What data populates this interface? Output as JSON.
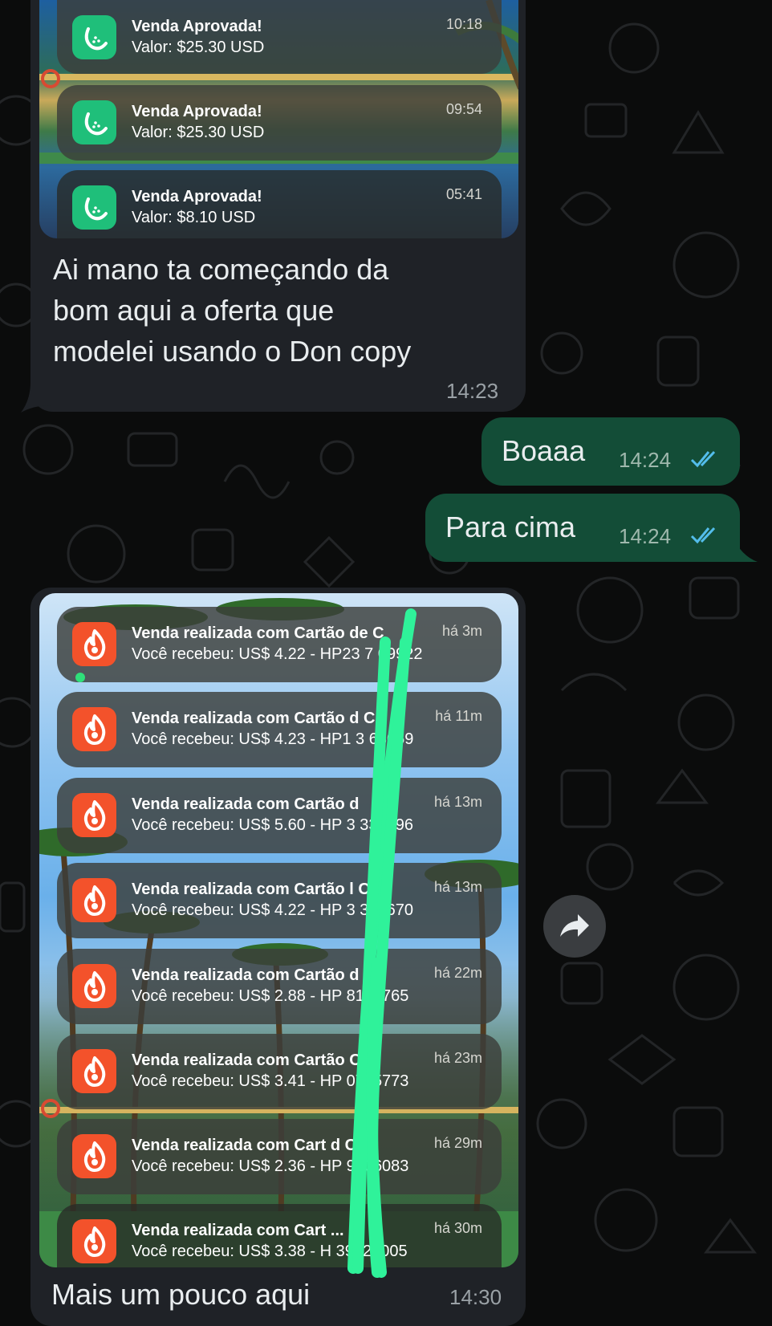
{
  "message1": {
    "notifications": [
      {
        "title": "Venda Aprovada!",
        "body": "Valor: $25.30 USD",
        "time": "10:18"
      },
      {
        "title": "Venda Aprovada!",
        "body": "Valor: $25.30 USD",
        "time": "09:54"
      },
      {
        "title": "Venda Aprovada!",
        "body": "Valor: $8.10 USD",
        "time": "05:41"
      }
    ],
    "text_line1": "Ai mano ta começando da",
    "text_line2": "bom aqui a oferta que",
    "text_line3": "modelei usando o Don copy",
    "time": "14:23"
  },
  "message2": {
    "text": "Boaaa",
    "time": "14:24",
    "status": "read"
  },
  "message3": {
    "text": "Para cima",
    "time": "14:24",
    "status": "read"
  },
  "message4": {
    "notifications": [
      {
        "title": "Venda realizada com Cartão de C",
        "body": "Você recebeu: US$ 4.22 - HP23  7 09922",
        "time": "há 3m"
      },
      {
        "title": "Venda realizada com Cartão d  C.",
        "body": "Você recebeu: US$ 4.23 - HP1 3   68059",
        "time": "há 11m"
      },
      {
        "title": "Venda realizada com Cartão d",
        "body": "Você recebeu: US$ 5.60 - HP  3  337996",
        "time": "há 13m"
      },
      {
        "title": "Venda realizada com Cartão  l C.",
        "body": "Você recebeu: US$ 4.22 - HP  3   385670",
        "time": "há 13m"
      },
      {
        "title": "Venda realizada com Cartão d  l...",
        "body": "Você recebeu: US$ 2.88 - HP   8161765",
        "time": "há 22m"
      },
      {
        "title": "Venda realizada com Cartão  C...",
        "body": "Você recebeu: US$ 3.41 - HP  0745773",
        "time": "há 23m"
      },
      {
        "title": "Venda realizada com Cart  d C...",
        "body": "Você recebeu: US$ 2.36 - HP  9706083",
        "time": "há 29m"
      },
      {
        "title": "Venda realizada com Cart   ...",
        "body": "Você recebeu: US$ 3.38 - H   39422005",
        "time": "há 30m"
      }
    ],
    "caption": "Mais um pouco aqui",
    "time": "14:30"
  },
  "colors": {
    "incoming_bubble": "#1f2227",
    "outgoing_bubble": "#134d37",
    "read_ticks": "#53bdeb",
    "scribble": "#2ff29a"
  },
  "icons": {
    "forward": "forward-arrow-icon",
    "app_green": "gourd-app-icon",
    "app_orange": "flame-app-icon"
  }
}
